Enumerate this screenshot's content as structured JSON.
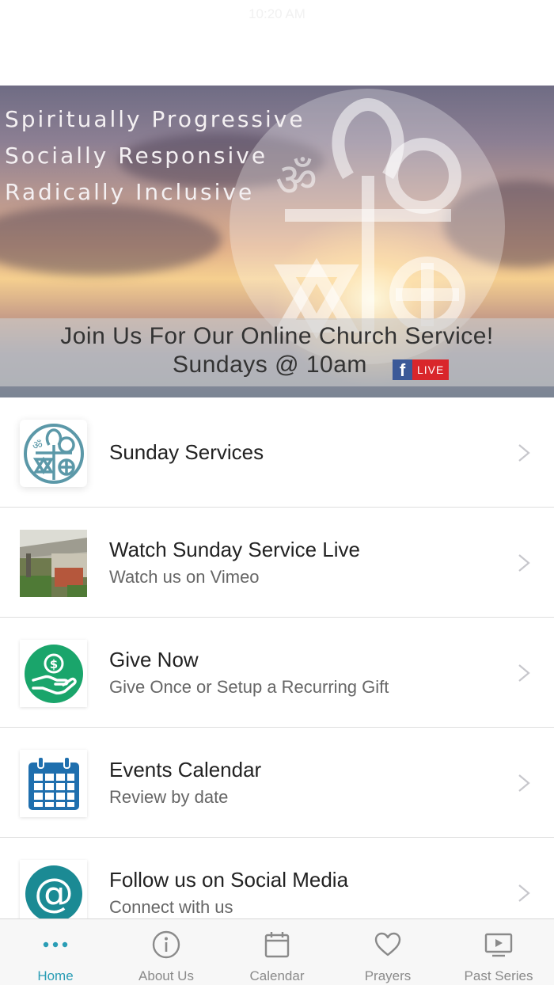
{
  "status_bar": {
    "time": "10:20 AM"
  },
  "hero": {
    "taglines": [
      "Spiritually Progressive",
      "Socially Responsive",
      "Radically Inclusive"
    ],
    "banner_line1": "Join Us For Our Online Church Service!",
    "banner_line2": "Sundays @ 10am",
    "fb_letter": "f",
    "live_label": "LIVE"
  },
  "menu": {
    "items": [
      {
        "title": "Sunday Services",
        "subtitle": "",
        "icon": "interfaith-symbols-icon"
      },
      {
        "title": "Watch Sunday Service Live",
        "subtitle": "Watch us on Vimeo",
        "icon": "church-photo-thumbnail"
      },
      {
        "title": "Give Now",
        "subtitle": "Give Once or Setup a Recurring Gift",
        "icon": "hand-coin-icon"
      },
      {
        "title": "Events Calendar",
        "subtitle": "Review by date",
        "icon": "calendar-icon"
      },
      {
        "title": "Follow us on Social Media",
        "subtitle": "Connect with us",
        "icon": "at-sign-icon"
      }
    ]
  },
  "tabbar": {
    "tabs": [
      {
        "label": "Home",
        "icon": "more-dots-icon",
        "active": true
      },
      {
        "label": "About Us",
        "icon": "info-icon",
        "active": false
      },
      {
        "label": "Calendar",
        "icon": "calendar-icon",
        "active": false
      },
      {
        "label": "Prayers",
        "icon": "heart-icon",
        "active": false
      },
      {
        "label": "Past Series",
        "icon": "play-screen-icon",
        "active": false
      }
    ]
  },
  "colors": {
    "accent": "#2a9db5",
    "give_green": "#1aa56b",
    "calendar_blue": "#1f6fae",
    "social_teal": "#1b8a94",
    "emblem_blue": "#5b98a8",
    "live_red": "#d9262b",
    "facebook_blue": "#3b5998"
  }
}
